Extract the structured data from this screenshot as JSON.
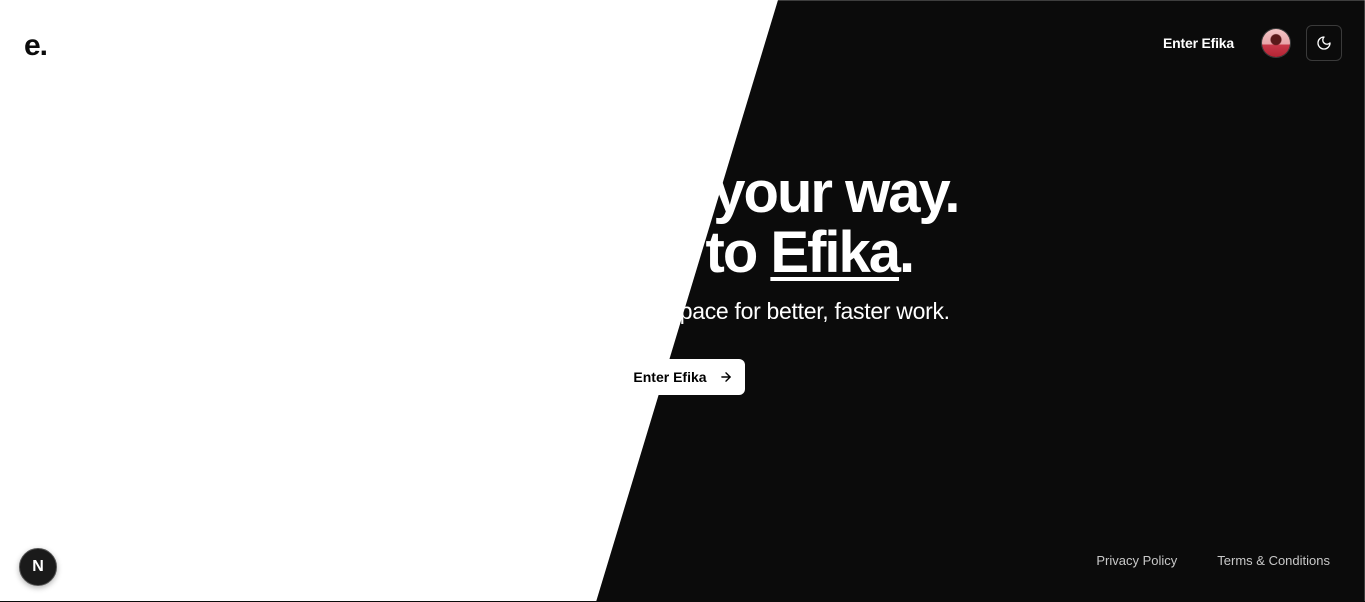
{
  "header": {
    "logo": "e.",
    "nav_link": "Enter Efika"
  },
  "hero": {
    "line1": "Your notes, your way.",
    "line2_prefix": "Welcome to ",
    "line2_brand": "Efika",
    "line2_suffix": ".",
    "subtitle": "Efika is a connected workspace for better, faster work.",
    "cta_label": "Enter Efika"
  },
  "footer": {
    "privacy": "Privacy Policy",
    "terms": "Terms & Conditions"
  },
  "badge": {
    "label": "N"
  },
  "icons": {
    "theme_toggle": "moon-icon",
    "cta_arrow": "arrow-right-icon"
  },
  "colors": {
    "dark": "#0b0b0b",
    "light": "#ffffff"
  }
}
